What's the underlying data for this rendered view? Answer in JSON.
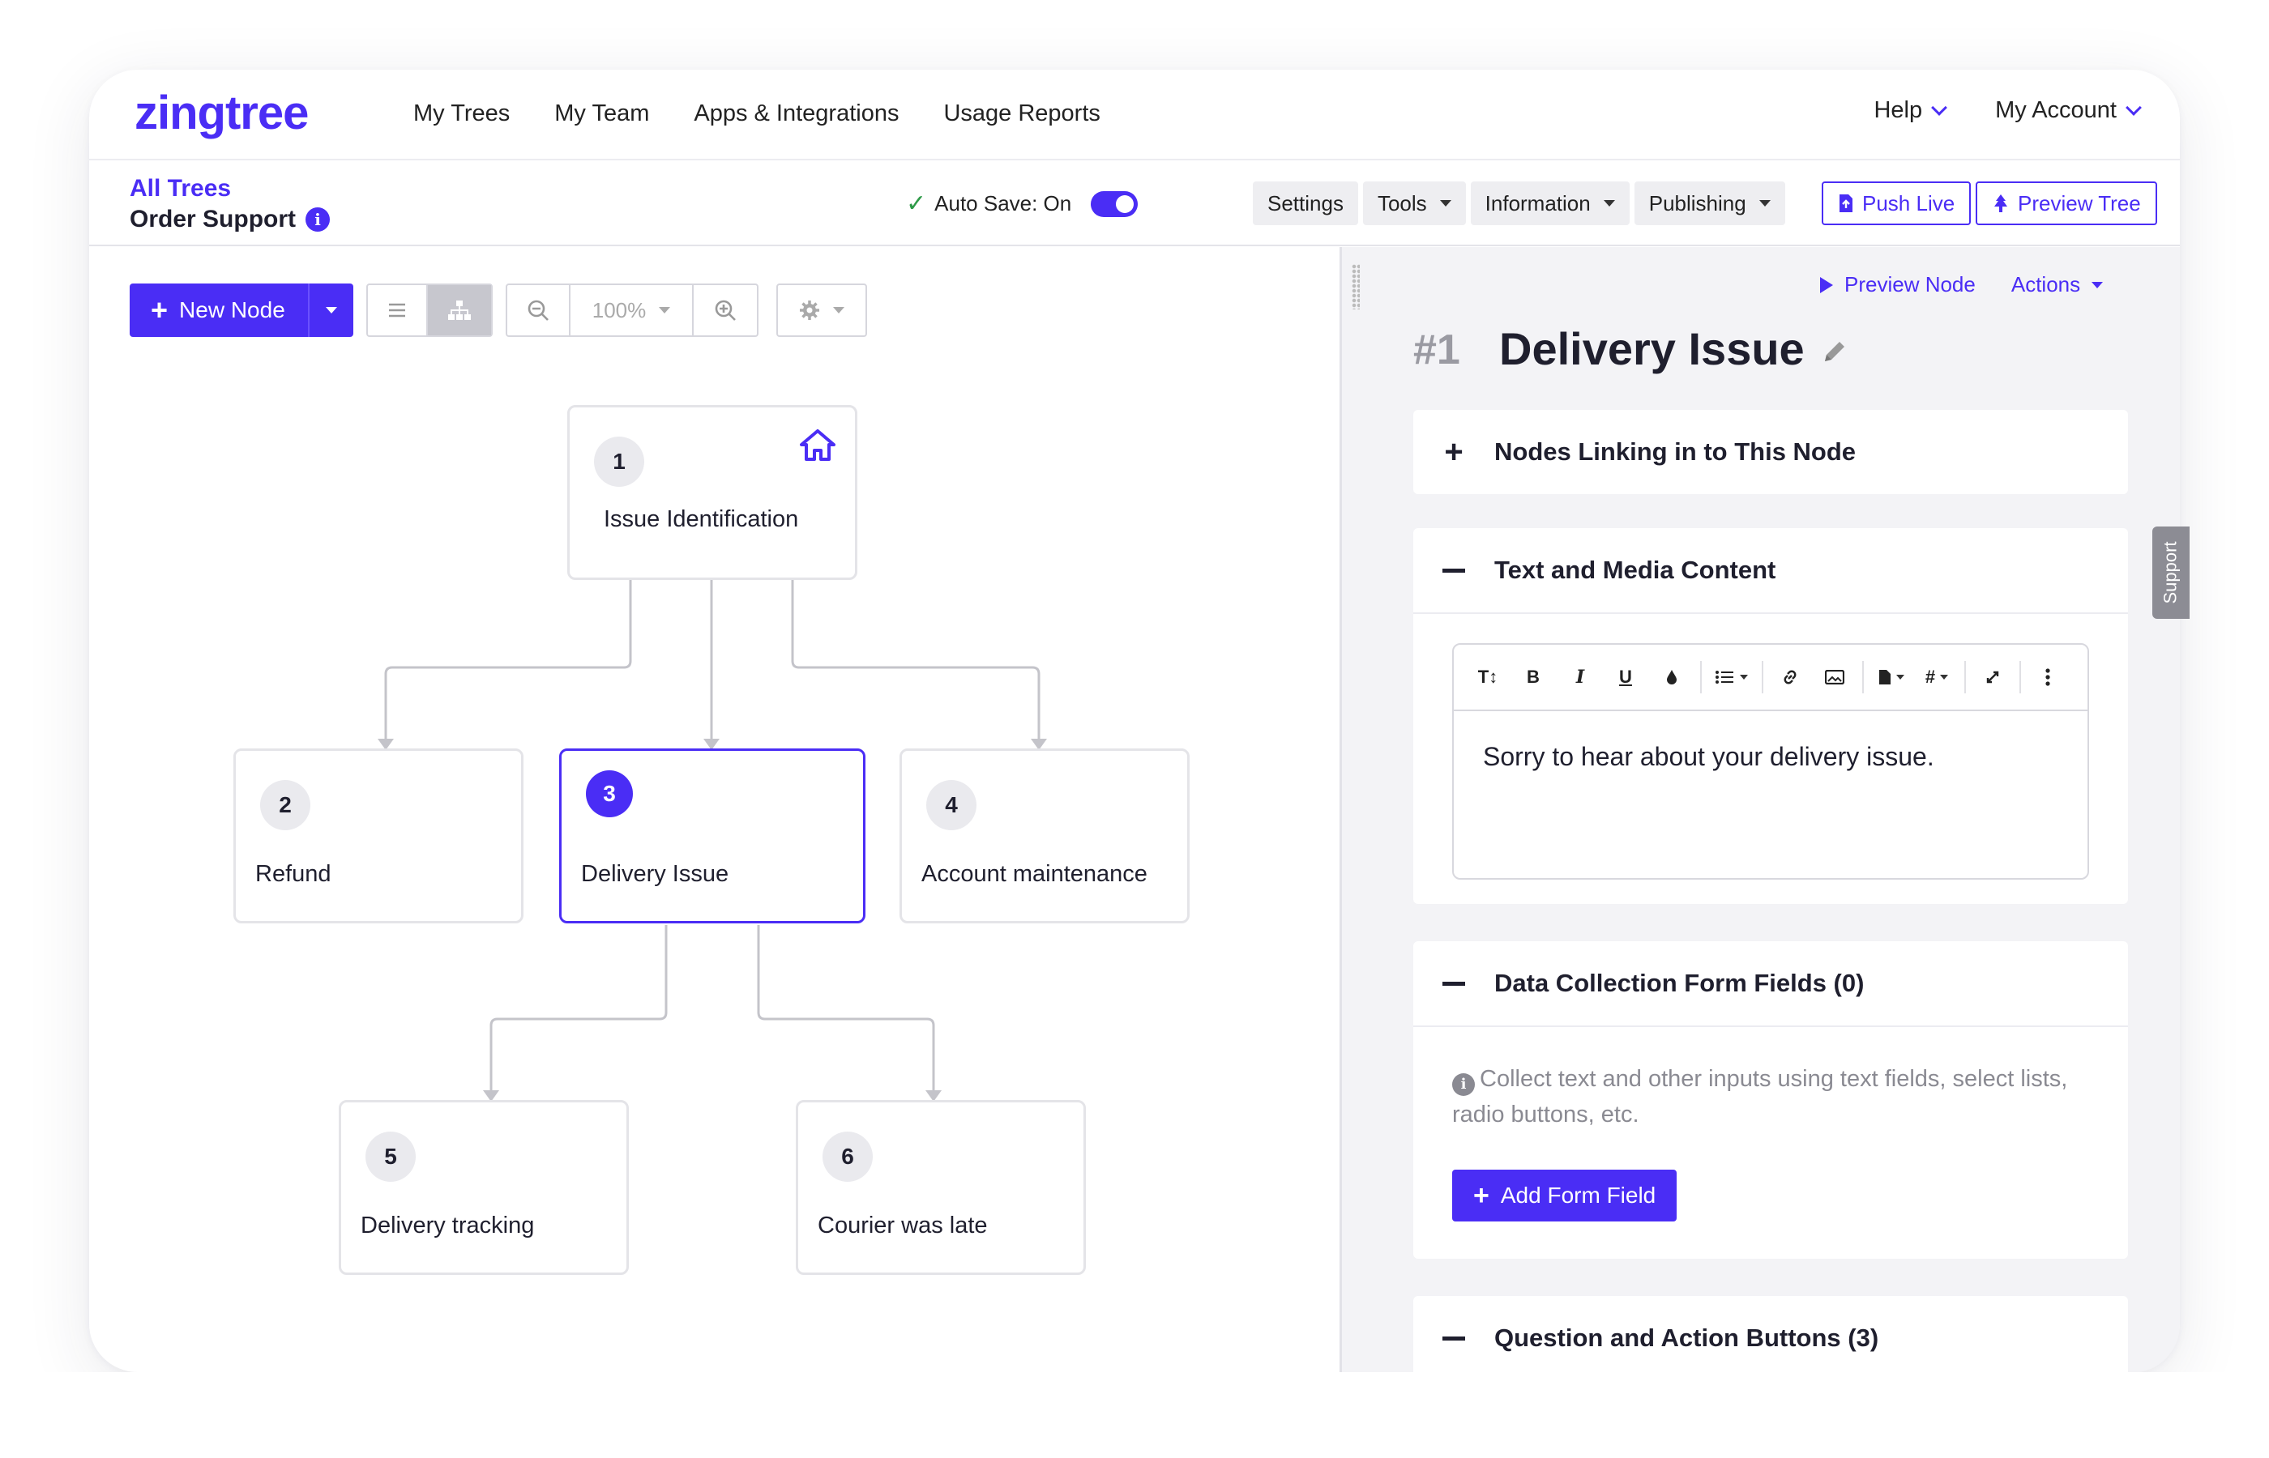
{
  "app": {
    "logo": "zingtree"
  },
  "nav": {
    "links": [
      "My Trees",
      "My Team",
      "Apps & Integrations",
      "Usage Reports"
    ],
    "help": "Help",
    "account": "My Account"
  },
  "toolbar": {
    "breadcrumb": "All Trees",
    "tree_name": "Order Support",
    "autosave_label": "Auto Save: On",
    "buttons": [
      "Settings",
      "Tools",
      "Information",
      "Publishing"
    ],
    "push_live": "Push Live",
    "preview_tree": "Preview Tree"
  },
  "canvas": {
    "new_node": "New Node",
    "zoom": "100%",
    "nodes": [
      {
        "num": "1",
        "label": "Issue Identification",
        "root": true
      },
      {
        "num": "2",
        "label": "Refund"
      },
      {
        "num": "3",
        "label": "Delivery Issue",
        "selected": true
      },
      {
        "num": "4",
        "label": "Account maintenance"
      },
      {
        "num": "5",
        "label": "Delivery tracking"
      },
      {
        "num": "6",
        "label": "Courier was late"
      }
    ]
  },
  "panel": {
    "preview_node": "Preview Node",
    "actions": "Actions",
    "node_id": "#1",
    "node_title": "Delivery Issue",
    "sections": {
      "linking": "Nodes Linking in to This Node",
      "content": "Text and Media Content",
      "content_text": "Sorry to hear about your delivery issue.",
      "form_fields": "Data Collection Form Fields (0)",
      "form_hint": "Collect text and other inputs using text fields, select lists, radio buttons, etc.",
      "add_form_field": "Add Form Field",
      "buttons": "Question and Action Buttons (3)"
    },
    "editor_tools": [
      "T↕",
      "B",
      "I",
      "U"
    ]
  },
  "support_tab": "Support",
  "colors": {
    "accent": "#4a2df5",
    "panel_bg": "#f3f3f6"
  }
}
